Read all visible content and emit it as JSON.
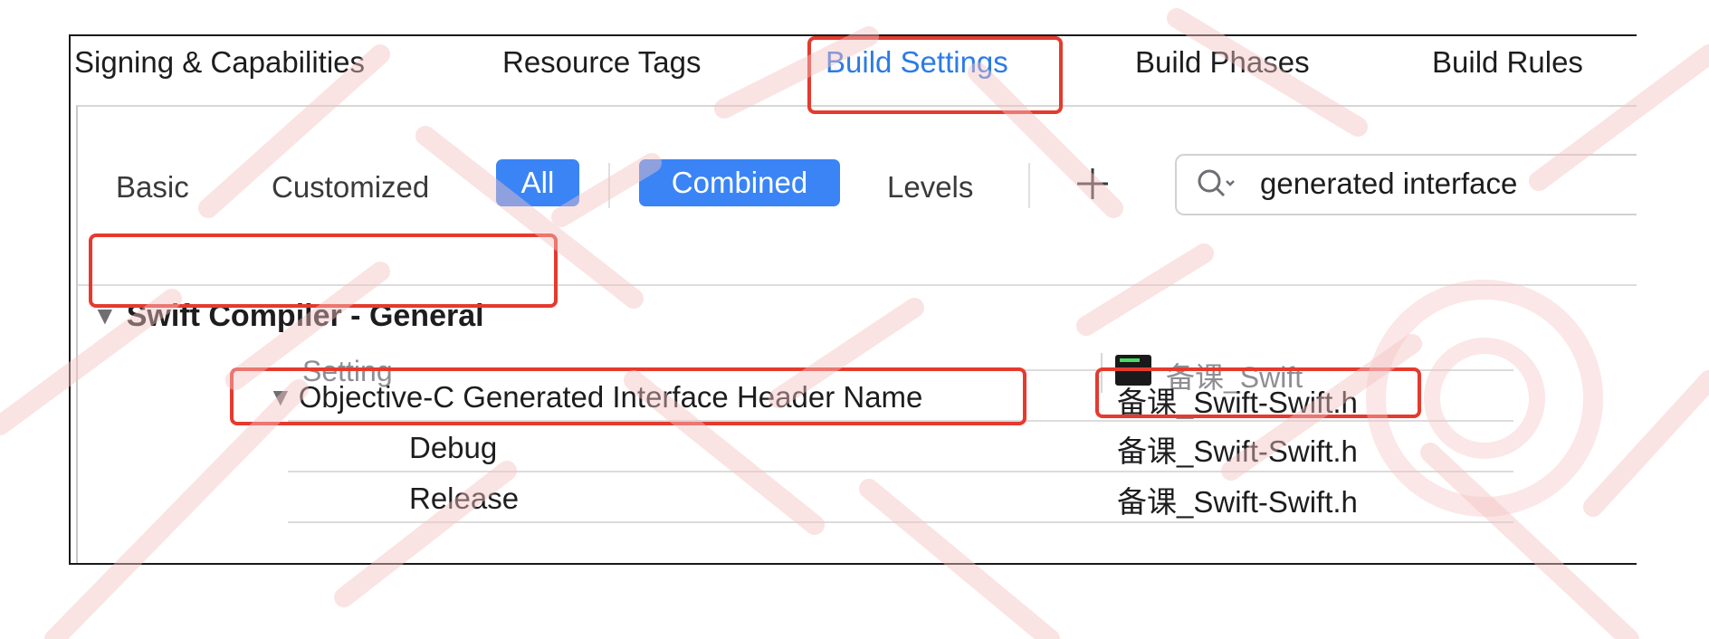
{
  "tabs": [
    "Signing & Capabilities",
    "Resource Tags",
    "Build Settings",
    "Build Phases",
    "Build Rules"
  ],
  "active_tab": "Build Settings",
  "filters": {
    "basic": "Basic",
    "customized": "Customized",
    "all": "All",
    "combined": "Combined",
    "levels": "Levels"
  },
  "search": {
    "value": "generated interface"
  },
  "section": {
    "title": "Swift Compiler - General"
  },
  "columns": {
    "setting": "Setting",
    "target": "备课_Swift"
  },
  "rows": [
    {
      "label": "Objective-C Generated Interface Header Name",
      "value": "备课_Swift-Swift.h"
    },
    {
      "label": "Debug",
      "value": "备课_Swift-Swift.h"
    },
    {
      "label": "Release",
      "value": "备课_Swift-Swift.h"
    }
  ],
  "colors": {
    "accent": "#3a84f6",
    "active_tab": "#2c7be5",
    "highlight": "#e53a2e"
  },
  "icons": [
    "plus-icon",
    "search-icon",
    "disclosure-triangle-icon",
    "terminal-app-icon"
  ]
}
